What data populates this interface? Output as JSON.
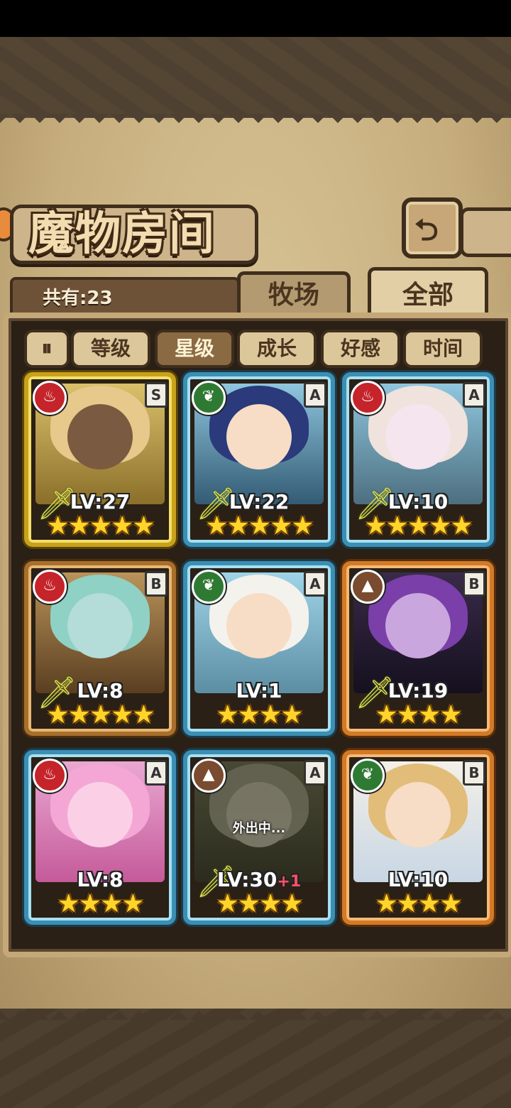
{
  "title": "魔物房间",
  "count_label": "共有:23",
  "tabs": [
    {
      "label": "牧场",
      "active": false
    },
    {
      "label": "全部",
      "active": true
    }
  ],
  "filters": {
    "toggle": "⏸",
    "items": [
      {
        "label": "等级",
        "active": false
      },
      {
        "label": "星级",
        "active": true
      },
      {
        "label": "成长",
        "active": false
      },
      {
        "label": "好感",
        "active": false
      },
      {
        "label": "时间",
        "active": false
      }
    ]
  },
  "monsters": [
    {
      "lv": "LV:27",
      "rank": "S",
      "element": "fire",
      "stars": "★★★★★",
      "frame": "gold"
    },
    {
      "lv": "LV:22",
      "rank": "A",
      "element": "leaf",
      "stars": "★★★★★",
      "frame": "blue"
    },
    {
      "lv": "LV:10",
      "rank": "A",
      "element": "fire",
      "stars": "★★★★★",
      "frame": "blue"
    },
    {
      "lv": "LV:8",
      "rank": "B",
      "element": "fire",
      "stars": "★★★★★",
      "frame": "bronze"
    },
    {
      "lv": "LV:1",
      "rank": "A",
      "element": "leaf",
      "stars": "★★★★",
      "frame": "blue"
    },
    {
      "lv": "LV:19",
      "rank": "B",
      "element": "earth",
      "stars": "★★★★",
      "frame": "orange"
    },
    {
      "lv": "LV:8",
      "rank": "A",
      "element": "fire",
      "stars": "★★★★",
      "frame": "blue"
    },
    {
      "lv": "LV:30",
      "lv_bonus": "+1",
      "rank": "A",
      "element": "earth",
      "stars": "★★★★",
      "frame": "blue",
      "status": "外出中..."
    },
    {
      "lv": "LV:10",
      "rank": "B",
      "element": "leaf",
      "stars": "★★★★",
      "frame": "orange"
    }
  ],
  "colors": {
    "fire": "#c4242a",
    "leaf": "#2f7a32",
    "earth": "#7a4b2e",
    "accent": "#ffd52a"
  }
}
